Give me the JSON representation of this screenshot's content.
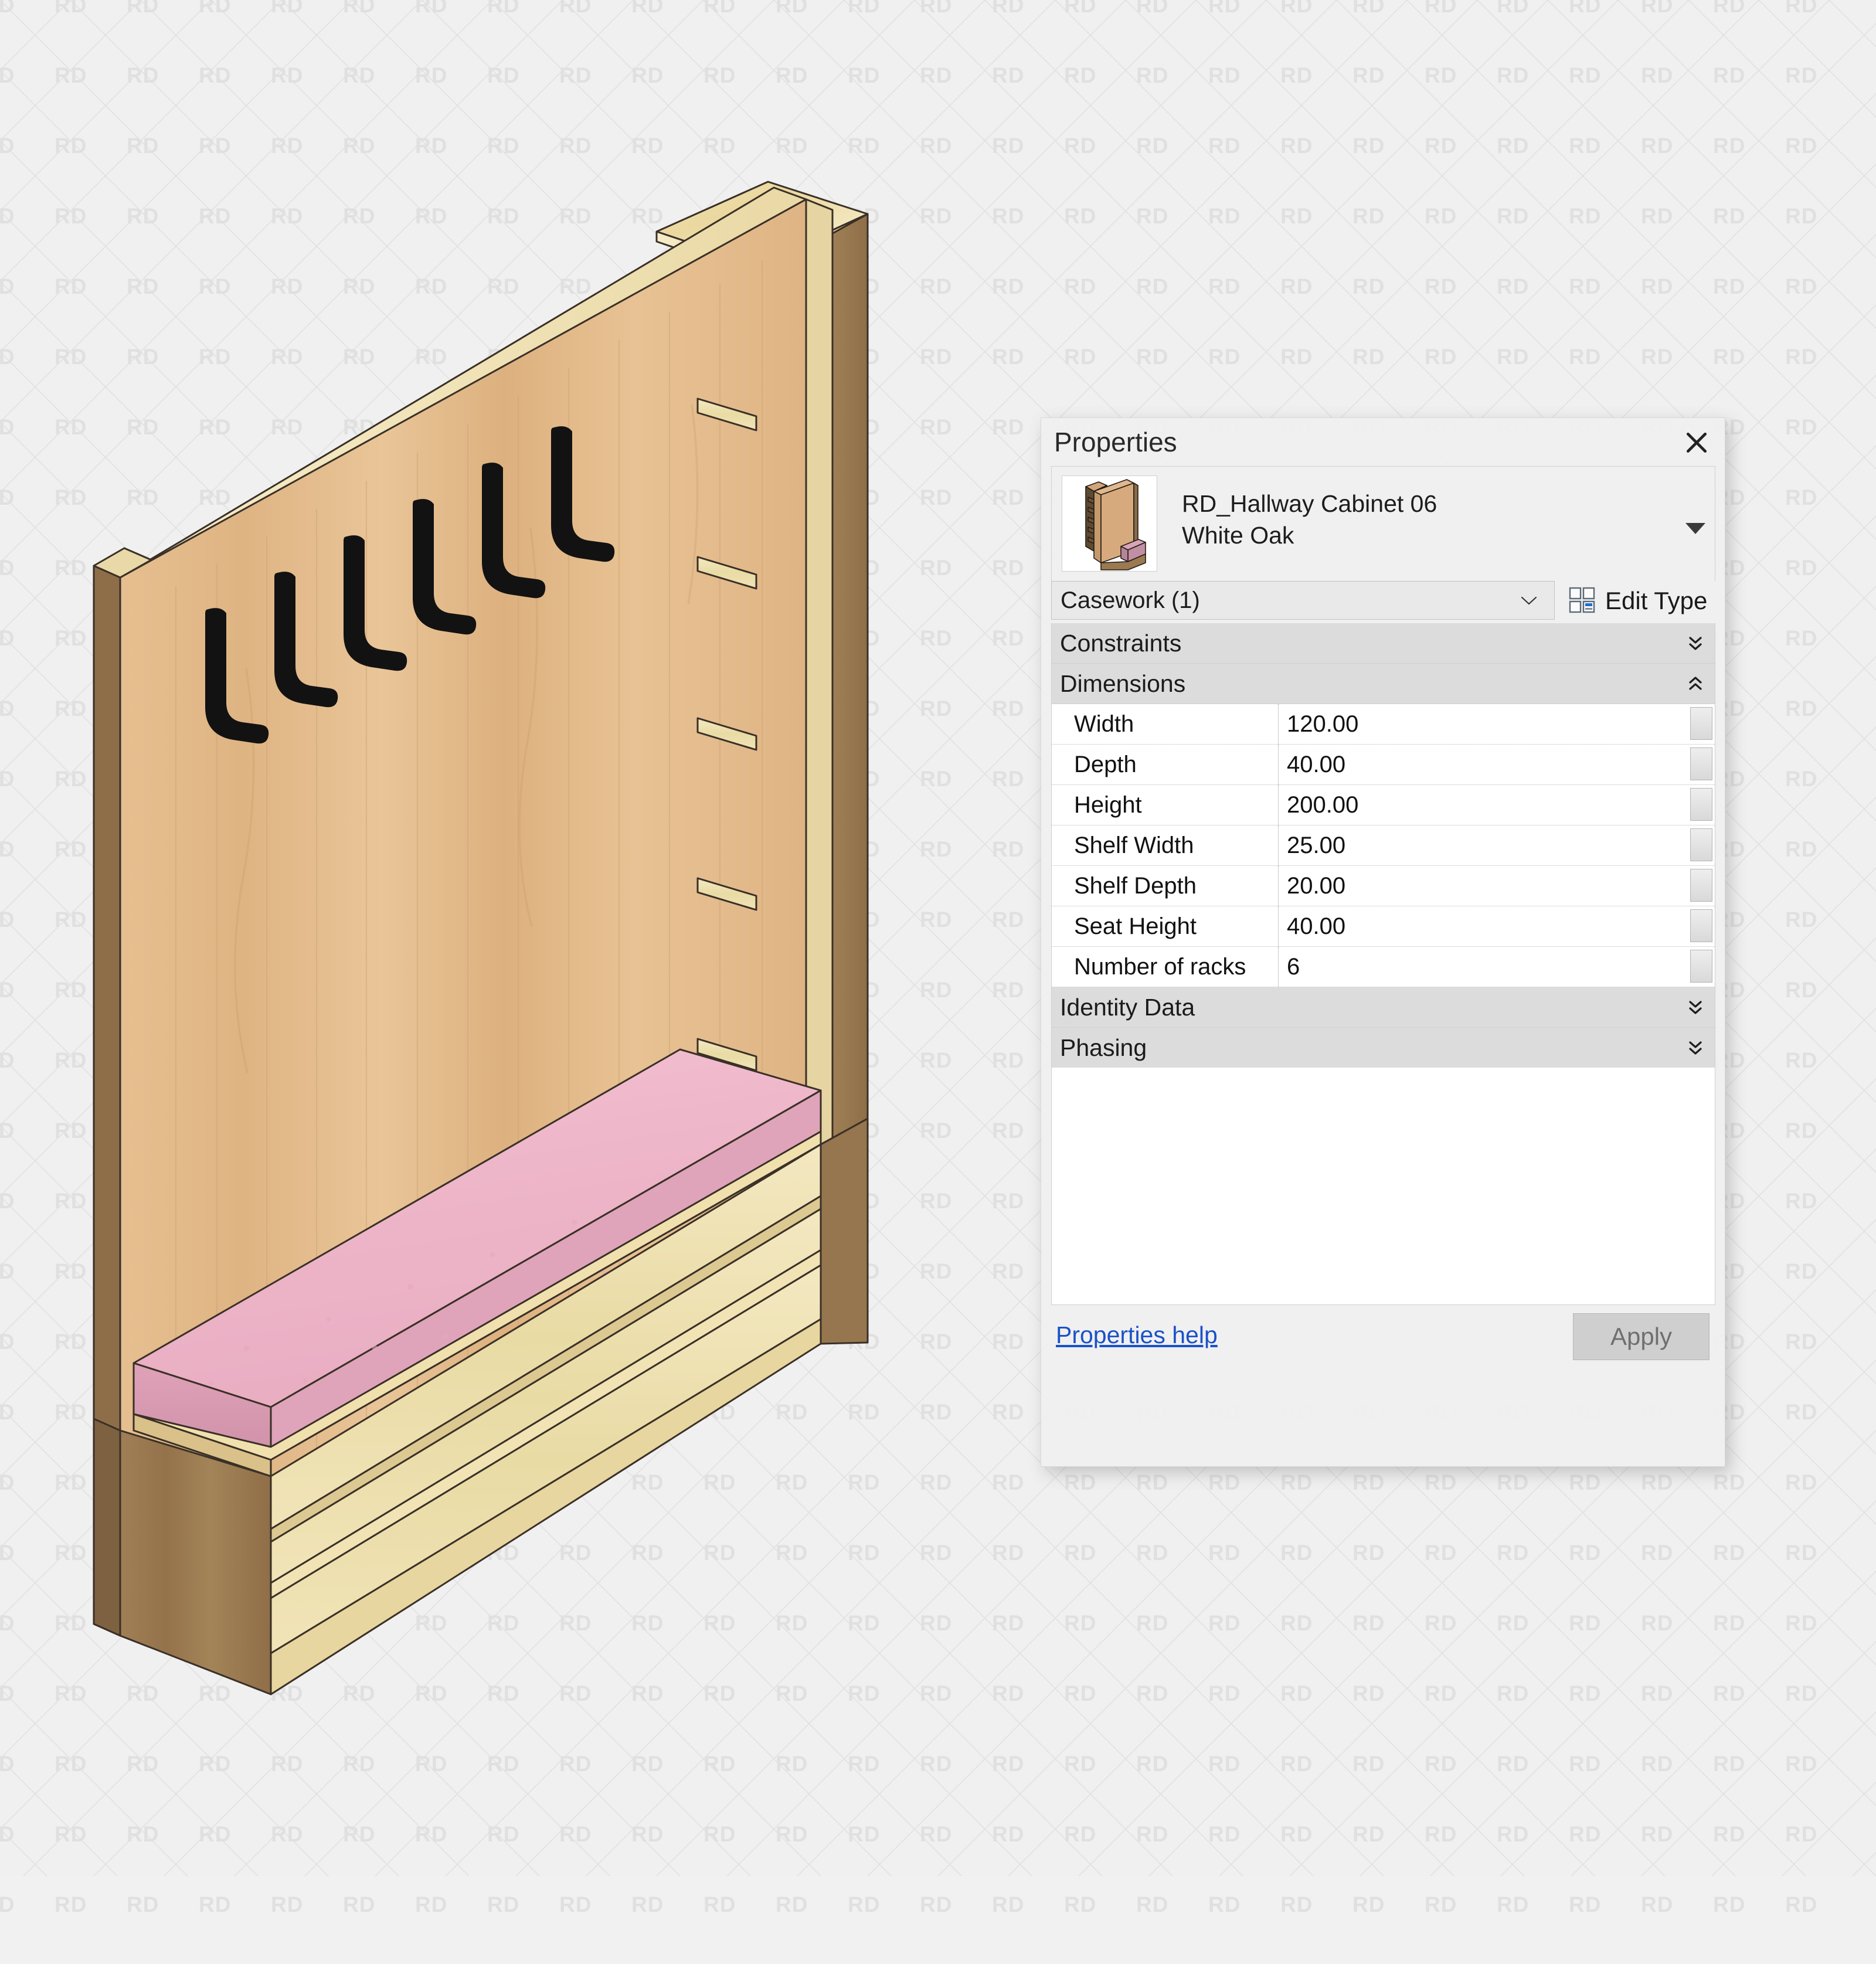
{
  "watermark": {
    "text": "RD"
  },
  "panel": {
    "title": "Properties",
    "close_icon": "close-icon",
    "type_name_line1": "RD_Hallway Cabinet 06",
    "type_name_line2": "White Oak",
    "type_dropdown_icon": "dropdown-triangle-icon",
    "family_select_value": "Casework (1)",
    "family_select_icon": "chevron-down-icon",
    "edit_type_label": "Edit Type",
    "edit_type_icon": "edit-type-grid-icon",
    "groups": [
      {
        "name": "Constraints",
        "state": "collapsed",
        "chevron_icon": "double-chevron-down-icon"
      },
      {
        "name": "Dimensions",
        "state": "expanded",
        "chevron_icon": "double-chevron-up-icon"
      }
    ],
    "parameters": [
      {
        "name": "Width",
        "value": "120.00"
      },
      {
        "name": "Depth",
        "value": "40.00"
      },
      {
        "name": "Height",
        "value": "200.00"
      },
      {
        "name": "Shelf Width",
        "value": "25.00"
      },
      {
        "name": "Shelf Depth",
        "value": "20.00"
      },
      {
        "name": "Seat Height",
        "value": "40.00"
      },
      {
        "name": "Number of racks",
        "value": "6"
      }
    ],
    "groups_bottom": [
      {
        "name": "Identity Data",
        "state": "collapsed",
        "chevron_icon": "double-chevron-down-icon"
      },
      {
        "name": "Phasing",
        "state": "collapsed",
        "chevron_icon": "double-chevron-down-icon"
      }
    ],
    "help_link": "Properties help",
    "apply_label": "Apply"
  },
  "model": {
    "name": "hallway-cabinet-isometric-3d-view",
    "hook_count": 6,
    "shelf_count": 5,
    "colors": {
      "back_panel_face": "#e0b584",
      "back_panel_face_light": "#e8c496",
      "side_panel_dark": "#9a7a52",
      "top_shelf_light": "#efdeb0",
      "edge_cream": "#f2e4bc",
      "cushion_pink": "#efb9cc",
      "cushion_pink_side": "#d99db2",
      "hook_black": "#121212",
      "outline": "#3a3027"
    }
  }
}
